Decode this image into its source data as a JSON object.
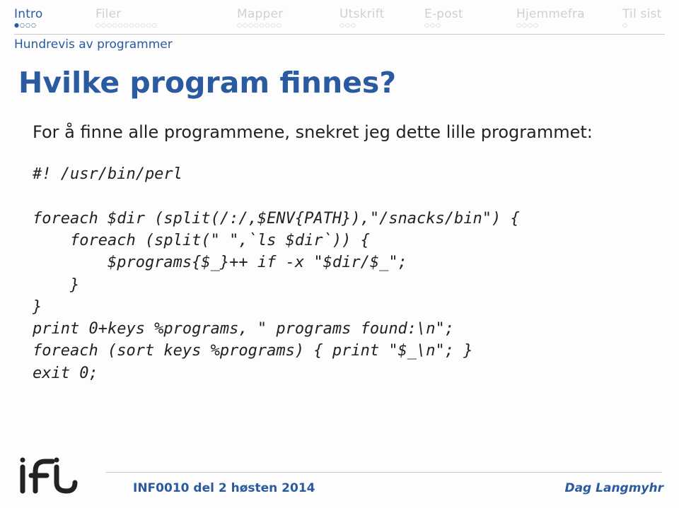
{
  "nav": {
    "items": [
      {
        "label": "Intro",
        "dots": "●○○○",
        "active": true
      },
      {
        "label": "Filer",
        "dots": "○○○○○○○○○○○",
        "active": false
      },
      {
        "label": "Mapper",
        "dots": "○○○○○○○○",
        "active": false
      },
      {
        "label": "Utskrift",
        "dots": "○○○",
        "active": false
      },
      {
        "label": "E-post",
        "dots": "○○○",
        "active": false
      },
      {
        "label": "Hjemmefra",
        "dots": "○○○○",
        "active": false
      },
      {
        "label": "Til sist",
        "dots": "○",
        "active": false
      }
    ]
  },
  "subsection": "Hundrevis av programmer",
  "title": "Hvilke program finnes?",
  "paragraph": "For å finne alle programmene, snekret jeg dette lille programmet:",
  "code": "#! /usr/bin/perl\n\nforeach $dir (split(/:/,$ENV{PATH}),\"/snacks/bin\") {\n    foreach (split(\" \",`ls $dir`)) {\n        $programs{$_}++ if -x \"$dir/$_\";\n    }\n}\nprint 0+keys %programs, \" programs found:\\n\";\nforeach (sort keys %programs) { print \"$_\\n\"; }\nexit 0;",
  "footer": {
    "left": "INF0010 del 2 høsten 2014",
    "right": "Dag Langmyhr"
  }
}
